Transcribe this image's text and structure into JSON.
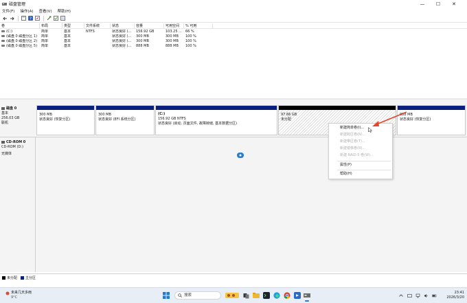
{
  "window": {
    "title": "磁盘管理",
    "minimize": "—",
    "maximize": "☐",
    "close": "✕"
  },
  "menu": [
    "文件(F)",
    "操作(A)",
    "查看(V)",
    "帮助(H)"
  ],
  "toolbar_icons": [
    "back-icon",
    "forward-icon",
    "properties-icon",
    "help-icon",
    "refresh-icon",
    "delete-icon",
    "check-icon",
    "view-icon"
  ],
  "volume_table": {
    "headers": [
      "卷",
      "布局",
      "类型",
      "文件系统",
      "状态",
      "容量",
      "可用空间",
      "% 可用"
    ],
    "rows": [
      [
        "(C:)",
        "简单",
        "基本",
        "NTFS",
        "状态良好 (...",
        "156.92 GB",
        "103.25 ...",
        "66 %"
      ],
      [
        "(磁盘 0 磁盘分区 1)",
        "简单",
        "基本",
        "",
        "状态良好 (...",
        "300 MB",
        "300 MB",
        "100 %"
      ],
      [
        "(磁盘 0 磁盘分区 2)",
        "简单",
        "基本",
        "",
        "状态良好 (...",
        "300 MB",
        "300 MB",
        "100 %"
      ],
      [
        "(磁盘 0 磁盘分区 5)",
        "简单",
        "基本",
        "",
        "状态良好 (...",
        "888 MB",
        "888 MB",
        "100 %"
      ]
    ]
  },
  "disk0": {
    "name": "磁盘 0",
    "type": "基本",
    "size": "256.03 GB",
    "status": "联机"
  },
  "partitions": [
    {
      "title": "",
      "size": "300 MB",
      "status": "状态良好 (恢复分区)"
    },
    {
      "title": "",
      "size": "300 MB",
      "status": "状态良好 (EFI 系统分区)"
    },
    {
      "title": "(C:)",
      "size": "156.92 GB NTFS",
      "status": "状态良好 (启动, 页面文件, 故障转储, 基本数据分区)"
    },
    {
      "title": "",
      "size": "97.66 GB",
      "status": "未分配"
    },
    {
      "title": "",
      "size": "888 MB",
      "status": "状态良好 (恢复分区)"
    }
  ],
  "cdrom": {
    "name": "CD-ROM 0",
    "drive": "CD-ROM (D:)",
    "media": "无媒体"
  },
  "context_menu": {
    "items": [
      {
        "label": "新建简单卷(I)...",
        "enabled": true
      },
      {
        "label": "新建跨区卷(N)...",
        "enabled": false
      },
      {
        "label": "新建带区卷(T)...",
        "enabled": false
      },
      {
        "label": "新建镜像卷(R)...",
        "enabled": false
      },
      {
        "label": "新建 RAID-5 卷(W)...",
        "enabled": false
      },
      {
        "label": "属性(P)",
        "enabled": true
      },
      {
        "label": "帮助(H)",
        "enabled": true
      }
    ]
  },
  "legend": [
    {
      "label": "未分配",
      "color": "#000000"
    },
    {
      "label": "主分区",
      "color": "#0a1f7e"
    }
  ],
  "taskbar": {
    "weather_text": "未来几天多雨",
    "temperature": "9°C",
    "search_placeholder": "搜索",
    "time": "23:41",
    "date": "2026/3/20"
  },
  "colors": {
    "primary_partition": "#0a1f7e",
    "unallocated": "#000000",
    "annotation_arrow": "#e0472b"
  }
}
